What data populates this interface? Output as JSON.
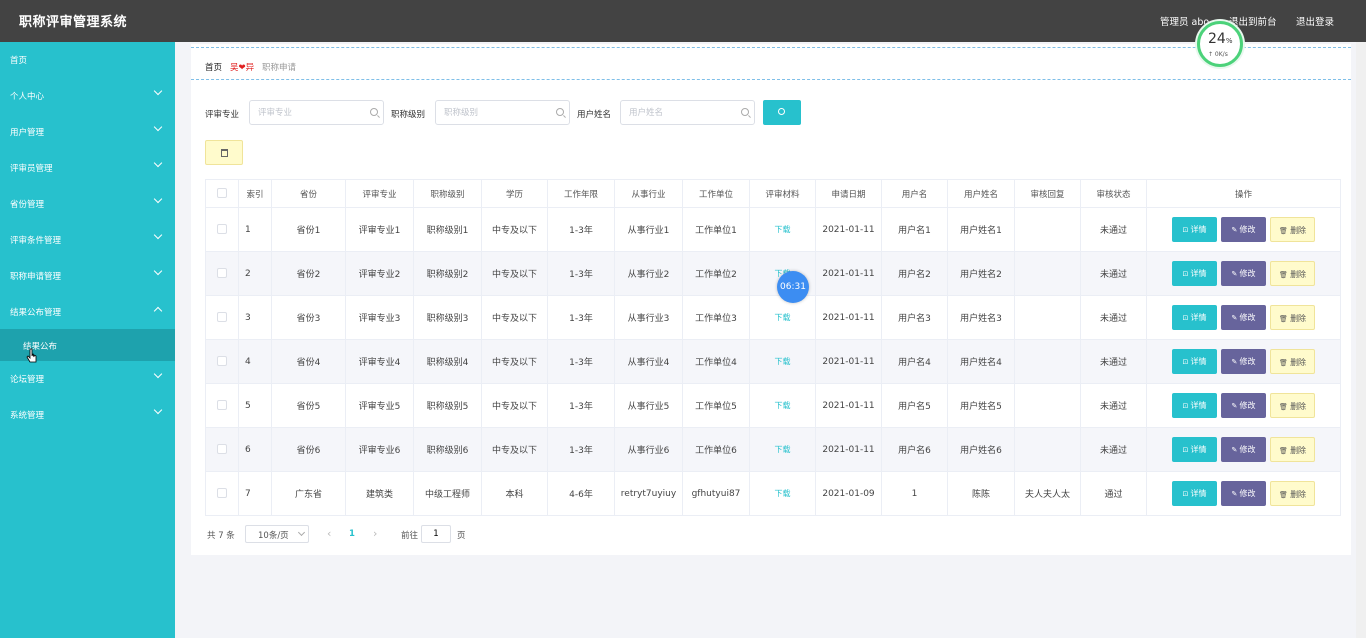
{
  "app": {
    "title": "职称评审管理系统",
    "admin_label": "管理员 abo",
    "front_label": "退出到前台",
    "logout_label": "退出登录"
  },
  "sidebar": {
    "items": [
      {
        "label": "首页",
        "chevron": "none"
      },
      {
        "label": "个人中心",
        "chevron": "down"
      },
      {
        "label": "用户管理",
        "chevron": "down"
      },
      {
        "label": "评审员管理",
        "chevron": "down"
      },
      {
        "label": "省份管理",
        "chevron": "down"
      },
      {
        "label": "评审条件管理",
        "chevron": "down"
      },
      {
        "label": "职称申请管理",
        "chevron": "down"
      },
      {
        "label": "结果公布管理",
        "chevron": "up"
      },
      {
        "label": "论坛管理",
        "chevron": "down"
      },
      {
        "label": "系统管理",
        "chevron": "down"
      }
    ],
    "active_sub": "结果公布"
  },
  "breadcrumb": {
    "home": "首页",
    "separator": "吴❤异",
    "current": "职称申请"
  },
  "filters": {
    "major": {
      "label": "评审专业",
      "placeholder": "评审专业"
    },
    "level": {
      "label": "职称级别",
      "placeholder": "职称级别"
    },
    "username": {
      "label": "用户姓名",
      "placeholder": "用户姓名"
    }
  },
  "table": {
    "headers": [
      "索引",
      "省份",
      "评审专业",
      "职称级别",
      "学历",
      "工作年限",
      "从事行业",
      "工作单位",
      "评审材料",
      "申请日期",
      "用户名",
      "用户姓名",
      "审核回复",
      "审核状态",
      "操作"
    ],
    "rows": [
      [
        "1",
        "省份1",
        "评审专业1",
        "职称级别1",
        "中专及以下",
        "1-3年",
        "从事行业1",
        "工作单位1",
        "下载",
        "2021-01-11",
        "用户名1",
        "用户姓名1",
        "",
        "未通过"
      ],
      [
        "2",
        "省份2",
        "评审专业2",
        "职称级别2",
        "中专及以下",
        "1-3年",
        "从事行业2",
        "工作单位2",
        "下载",
        "2021-01-11",
        "用户名2",
        "用户姓名2",
        "",
        "未通过"
      ],
      [
        "3",
        "省份3",
        "评审专业3",
        "职称级别3",
        "中专及以下",
        "1-3年",
        "从事行业3",
        "工作单位3",
        "下载",
        "2021-01-11",
        "用户名3",
        "用户姓名3",
        "",
        "未通过"
      ],
      [
        "4",
        "省份4",
        "评审专业4",
        "职称级别4",
        "中专及以下",
        "1-3年",
        "从事行业4",
        "工作单位4",
        "下载",
        "2021-01-11",
        "用户名4",
        "用户姓名4",
        "",
        "未通过"
      ],
      [
        "5",
        "省份5",
        "评审专业5",
        "职称级别5",
        "中专及以下",
        "1-3年",
        "从事行业5",
        "工作单位5",
        "下载",
        "2021-01-11",
        "用户名5",
        "用户姓名5",
        "",
        "未通过"
      ],
      [
        "6",
        "省份6",
        "评审专业6",
        "职称级别6",
        "中专及以下",
        "1-3年",
        "从事行业6",
        "工作单位6",
        "下载",
        "2021-01-11",
        "用户名6",
        "用户姓名6",
        "",
        "未通过"
      ],
      [
        "7",
        "广东省",
        "建筑类",
        "中级工程师",
        "本科",
        "4-6年",
        "retryt7uyiuy",
        "gfhutyui87",
        "下载",
        "2021-01-09",
        "1",
        "陈陈",
        "夫人夫人太",
        "通过"
      ]
    ],
    "actions": {
      "detail": "详情",
      "edit": "修改",
      "delete": "删除"
    }
  },
  "pagination": {
    "total": "共 7 条",
    "page_size": "10条/页",
    "current": "1",
    "goto": "前往",
    "goto_value": "1",
    "page_suffix": "页"
  },
  "overlays": {
    "speed_percent": "24",
    "speed_unit": "%",
    "speed_rate": "↑ 0K/s",
    "timer": "06:31"
  }
}
